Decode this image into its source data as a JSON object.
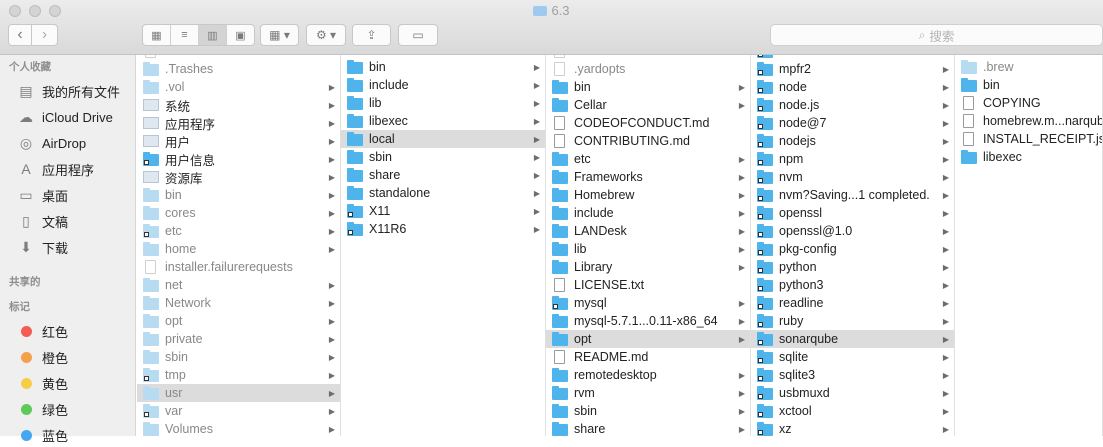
{
  "window": {
    "title": "6.3"
  },
  "toolbar": {
    "back_label": "‹",
    "forward_label": "›",
    "view_modes": [
      "icons",
      "list",
      "columns",
      "cover-flow"
    ],
    "active_view": "columns",
    "search_placeholder": "搜索"
  },
  "sidebar": {
    "sections": [
      {
        "heading": "个人收藏",
        "items": [
          {
            "label": "我的所有文件",
            "icon": "all-files-icon",
            "glyph": "▤"
          },
          {
            "label": "iCloud Drive",
            "icon": "cloud-icon",
            "glyph": "☁"
          },
          {
            "label": "AirDrop",
            "icon": "airdrop-icon",
            "glyph": "◎"
          },
          {
            "label": "应用程序",
            "icon": "applications-icon",
            "glyph": "A"
          },
          {
            "label": "桌面",
            "icon": "desktop-icon",
            "glyph": "▭"
          },
          {
            "label": "文稿",
            "icon": "documents-icon",
            "glyph": "▯"
          },
          {
            "label": "下载",
            "icon": "downloads-icon",
            "glyph": "⬇"
          }
        ]
      },
      {
        "heading": "共享的",
        "items": []
      },
      {
        "heading": "标记",
        "items": [
          {
            "label": "红色",
            "color": "#f45b52"
          },
          {
            "label": "橙色",
            "color": "#f5a04a"
          },
          {
            "label": "黄色",
            "color": "#f6cd47"
          },
          {
            "label": "绿色",
            "color": "#5dcb5b"
          },
          {
            "label": "蓝色",
            "color": "#45a6f2"
          }
        ]
      }
    ]
  },
  "columns": [
    {
      "name": "root",
      "items": [
        {
          "name": "",
          "kind": "file",
          "dim": true
        },
        {
          "name": ".Trashes",
          "kind": "folder",
          "dim": true
        },
        {
          "name": ".vol",
          "kind": "folder",
          "dim": true,
          "arrow": true
        },
        {
          "name": "系统",
          "kind": "special",
          "arrow": true
        },
        {
          "name": "应用程序",
          "kind": "special",
          "arrow": true
        },
        {
          "name": "用户",
          "kind": "special",
          "arrow": true
        },
        {
          "name": "用户信息",
          "kind": "folder",
          "alias": true,
          "arrow": true
        },
        {
          "name": "资源库",
          "kind": "special",
          "arrow": true
        },
        {
          "name": "bin",
          "kind": "folder",
          "dim": true,
          "arrow": true
        },
        {
          "name": "cores",
          "kind": "folder",
          "dim": true,
          "arrow": true
        },
        {
          "name": "etc",
          "kind": "folder",
          "dim": true,
          "alias": true,
          "arrow": true
        },
        {
          "name": "home",
          "kind": "folder",
          "dim": true,
          "arrow": true
        },
        {
          "name": "installer.failurerequests",
          "kind": "file",
          "dim": true
        },
        {
          "name": "net",
          "kind": "folder",
          "dim": true,
          "arrow": true
        },
        {
          "name": "Network",
          "kind": "folder",
          "dim": true,
          "arrow": true
        },
        {
          "name": "opt",
          "kind": "folder",
          "dim": true,
          "arrow": true
        },
        {
          "name": "private",
          "kind": "folder",
          "dim": true,
          "arrow": true
        },
        {
          "name": "sbin",
          "kind": "folder",
          "dim": true,
          "arrow": true
        },
        {
          "name": "tmp",
          "kind": "folder",
          "dim": true,
          "alias": true,
          "arrow": true
        },
        {
          "name": "usr",
          "kind": "folder",
          "dim": true,
          "arrow": true,
          "selected": true
        },
        {
          "name": "var",
          "kind": "folder",
          "dim": true,
          "alias": true,
          "arrow": true
        },
        {
          "name": "Volumes",
          "kind": "folder",
          "dim": true,
          "arrow": true
        }
      ]
    },
    {
      "name": "usr",
      "items": [
        {
          "name": "bin",
          "kind": "folder",
          "arrow": true
        },
        {
          "name": "include",
          "kind": "folder",
          "arrow": true
        },
        {
          "name": "lib",
          "kind": "folder",
          "arrow": true
        },
        {
          "name": "libexec",
          "kind": "folder",
          "arrow": true
        },
        {
          "name": "local",
          "kind": "folder",
          "arrow": true,
          "selected": true
        },
        {
          "name": "sbin",
          "kind": "folder",
          "arrow": true
        },
        {
          "name": "share",
          "kind": "folder",
          "arrow": true
        },
        {
          "name": "standalone",
          "kind": "folder",
          "arrow": true
        },
        {
          "name": "X11",
          "kind": "folder",
          "alias": true,
          "arrow": true
        },
        {
          "name": "X11R6",
          "kind": "folder",
          "alias": true,
          "arrow": true
        }
      ]
    },
    {
      "name": "local",
      "items": [
        {
          "name": "",
          "kind": "file",
          "dim": true
        },
        {
          "name": ".yardopts",
          "kind": "file",
          "dim": true
        },
        {
          "name": "bin",
          "kind": "folder",
          "arrow": true
        },
        {
          "name": "Cellar",
          "kind": "folder",
          "arrow": true
        },
        {
          "name": "CODEOFCONDUCT.md",
          "kind": "file"
        },
        {
          "name": "CONTRIBUTING.md",
          "kind": "file"
        },
        {
          "name": "etc",
          "kind": "folder",
          "arrow": true
        },
        {
          "name": "Frameworks",
          "kind": "folder",
          "arrow": true
        },
        {
          "name": "Homebrew",
          "kind": "folder",
          "arrow": true
        },
        {
          "name": "include",
          "kind": "folder",
          "arrow": true
        },
        {
          "name": "LANDesk",
          "kind": "folder",
          "arrow": true
        },
        {
          "name": "lib",
          "kind": "folder",
          "arrow": true
        },
        {
          "name": "Library",
          "kind": "folder",
          "arrow": true
        },
        {
          "name": "LICENSE.txt",
          "kind": "file"
        },
        {
          "name": "mysql",
          "kind": "folder",
          "alias": true,
          "arrow": true
        },
        {
          "name": "mysql-5.7.1...0.11-x86_64",
          "kind": "folder",
          "arrow": true
        },
        {
          "name": "opt",
          "kind": "folder",
          "arrow": true,
          "selected": true
        },
        {
          "name": "README.md",
          "kind": "file"
        },
        {
          "name": "remotedesktop",
          "kind": "folder",
          "arrow": true
        },
        {
          "name": "rvm",
          "kind": "folder",
          "arrow": true
        },
        {
          "name": "sbin",
          "kind": "folder",
          "arrow": true
        },
        {
          "name": "share",
          "kind": "folder",
          "arrow": true
        }
      ]
    },
    {
      "name": "opt",
      "items": [
        {
          "name": "",
          "kind": "folder",
          "alias": true,
          "arrow": true
        },
        {
          "name": "mpfr2",
          "kind": "folder",
          "alias": true,
          "arrow": true
        },
        {
          "name": "node",
          "kind": "folder",
          "alias": true,
          "arrow": true
        },
        {
          "name": "node.js",
          "kind": "folder",
          "alias": true,
          "arrow": true
        },
        {
          "name": "node@7",
          "kind": "folder",
          "alias": true,
          "arrow": true
        },
        {
          "name": "nodejs",
          "kind": "folder",
          "alias": true,
          "arrow": true
        },
        {
          "name": "npm",
          "kind": "folder",
          "alias": true,
          "arrow": true
        },
        {
          "name": "nvm",
          "kind": "folder",
          "alias": true,
          "arrow": true
        },
        {
          "name": "nvm?Saving...1 completed.",
          "kind": "folder",
          "alias": true,
          "arrow": true
        },
        {
          "name": "openssl",
          "kind": "folder",
          "alias": true,
          "arrow": true
        },
        {
          "name": "openssl@1.0",
          "kind": "folder",
          "alias": true,
          "arrow": true
        },
        {
          "name": "pkg-config",
          "kind": "folder",
          "alias": true,
          "arrow": true
        },
        {
          "name": "python",
          "kind": "folder",
          "alias": true,
          "arrow": true
        },
        {
          "name": "python3",
          "kind": "folder",
          "alias": true,
          "arrow": true
        },
        {
          "name": "readline",
          "kind": "folder",
          "alias": true,
          "arrow": true
        },
        {
          "name": "ruby",
          "kind": "folder",
          "alias": true,
          "arrow": true
        },
        {
          "name": "sonarqube",
          "kind": "folder",
          "alias": true,
          "arrow": true,
          "selected": true
        },
        {
          "name": "sqlite",
          "kind": "folder",
          "alias": true,
          "arrow": true
        },
        {
          "name": "sqlite3",
          "kind": "folder",
          "alias": true,
          "arrow": true
        },
        {
          "name": "usbmuxd",
          "kind": "folder",
          "alias": true,
          "arrow": true
        },
        {
          "name": "xctool",
          "kind": "folder",
          "alias": true,
          "arrow": true
        },
        {
          "name": "xz",
          "kind": "folder",
          "alias": true,
          "arrow": true
        }
      ]
    },
    {
      "name": "sonarqube",
      "items": [
        {
          "name": ".brew",
          "kind": "folder",
          "dim": true
        },
        {
          "name": "bin",
          "kind": "folder"
        },
        {
          "name": "COPYING",
          "kind": "file"
        },
        {
          "name": "homebrew.m...narqube.plist",
          "kind": "file"
        },
        {
          "name": "INSTALL_RECEIPT.json",
          "kind": "file"
        },
        {
          "name": "libexec",
          "kind": "folder"
        }
      ]
    }
  ]
}
